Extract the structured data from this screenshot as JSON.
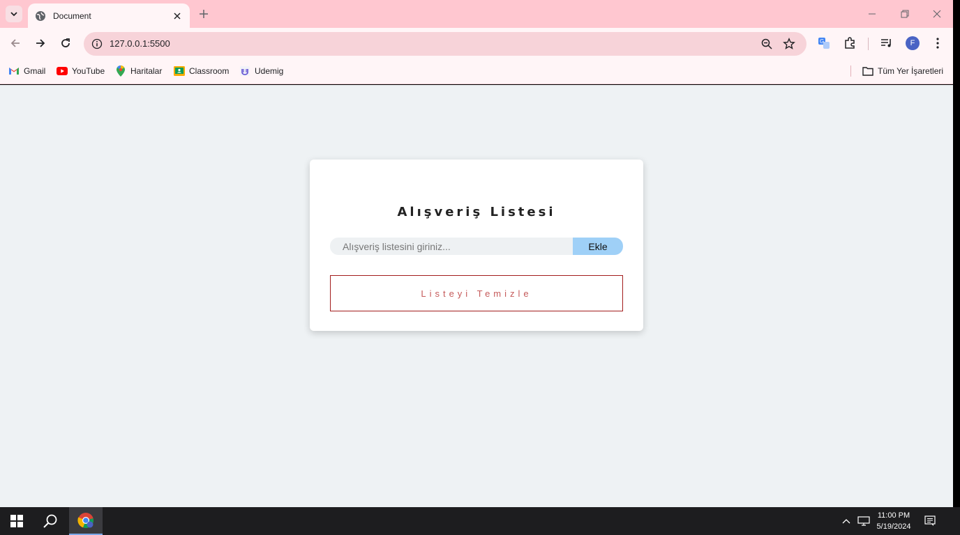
{
  "browser": {
    "tab_title": "Document",
    "url": "127.0.0.1:5500",
    "profile_initial": "F",
    "bookmarks": [
      {
        "label": "Gmail",
        "icon": "gmail-icon"
      },
      {
        "label": "YouTube",
        "icon": "youtube-icon"
      },
      {
        "label": "Haritalar",
        "icon": "maps-icon"
      },
      {
        "label": "Classroom",
        "icon": "classroom-icon"
      },
      {
        "label": "Udemig",
        "icon": "udemig-icon"
      }
    ],
    "all_bookmarks_label": "Tüm Yer İşaretleri"
  },
  "page": {
    "title": "Alışveriş Listesi",
    "input_placeholder": "Alışveriş listesini giriniz...",
    "add_label": "Ekle",
    "clear_label": "Listeyi Temizle"
  },
  "taskbar": {
    "time": "11:00 PM",
    "date": "5/19/2024"
  },
  "colors": {
    "tabstrip": "#ffc7d0",
    "add_button": "#9fd0f7",
    "clear_border": "#a21c1c",
    "clear_text": "#c55a5a"
  }
}
